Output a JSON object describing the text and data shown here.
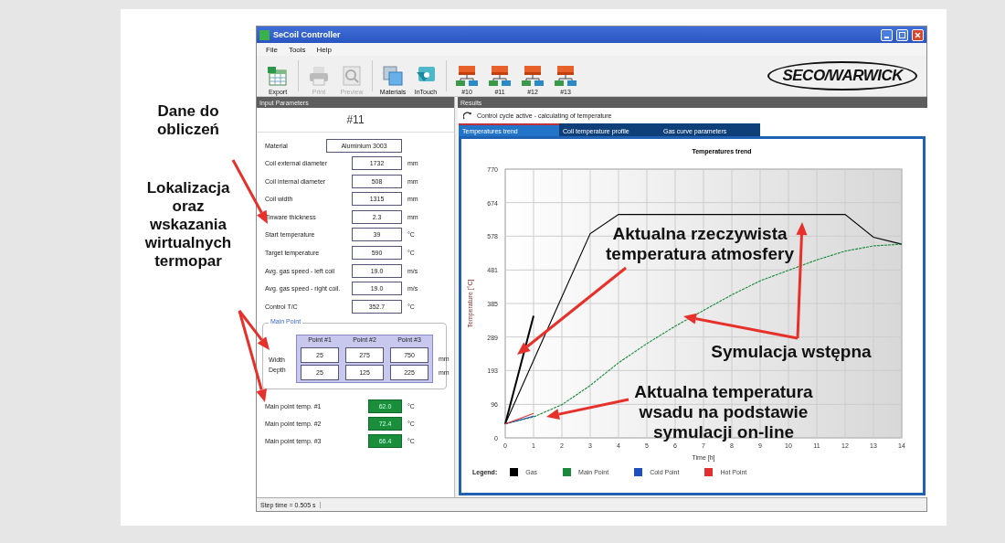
{
  "annotations_left": [
    {
      "text": "Dane do obliczeń"
    },
    {
      "text": "Lokalizacja oraz wskazania wirtualnych termopar"
    }
  ],
  "window": {
    "title": "SeCoil Controller",
    "menu": [
      "File",
      "Tools",
      "Help"
    ],
    "toolbar": [
      {
        "kind": "export",
        "label": "Export",
        "disabled": false
      },
      {
        "kind": "print",
        "label": "Print",
        "disabled": true
      },
      {
        "kind": "preview",
        "label": "Preview",
        "disabled": true
      },
      {
        "kind": "materials",
        "label": "Materials",
        "disabled": false
      },
      {
        "kind": "intouch",
        "label": "InTouch",
        "disabled": false
      },
      {
        "kind": "coil",
        "label": "#10",
        "disabled": false
      },
      {
        "kind": "coil",
        "label": "#11",
        "disabled": false
      },
      {
        "kind": "coil",
        "label": "#12",
        "disabled": false
      },
      {
        "kind": "coil",
        "label": "#13",
        "disabled": false
      }
    ],
    "logo": "SECO/WARWICK"
  },
  "input_panel": {
    "title": "Input Parameters",
    "coil": "#11",
    "fields": [
      {
        "kind": "wide",
        "label": "Material",
        "value": "Aluminium 3003"
      },
      {
        "kind": "number",
        "label": "Coil external diameter",
        "value": "1732",
        "unit": "mm"
      },
      {
        "kind": "number",
        "label": "Coil internal diameter",
        "value": "508",
        "unit": "mm"
      },
      {
        "kind": "number",
        "label": "Coil width",
        "value": "1315",
        "unit": "mm"
      },
      {
        "kind": "number",
        "label": "Tinware thickness",
        "value": "2.3",
        "unit": "mm"
      },
      {
        "kind": "number",
        "label": "Start temperature",
        "value": "39",
        "unit": "°C"
      },
      {
        "kind": "number",
        "label": "Target temperature",
        "value": "590",
        "unit": "°C"
      },
      {
        "kind": "number",
        "label": "Avg. gas speed - left coil",
        "value": "19.0",
        "unit": "m/s"
      },
      {
        "kind": "number",
        "label": "Avg. gas speed - right coil.",
        "value": "19.0",
        "unit": "m/s"
      },
      {
        "kind": "number",
        "label": "Control T/C",
        "value": "352.7",
        "unit": "°C"
      }
    ],
    "main_point": {
      "title": "Main Point",
      "columns": [
        "Point #1",
        "Point #2",
        "Point #3"
      ],
      "rows": [
        {
          "label": "Width",
          "values": [
            "25",
            "275",
            "750"
          ],
          "unit": "mm"
        },
        {
          "label": "Depth",
          "values": [
            "25",
            "125",
            "225"
          ],
          "unit": "mm"
        }
      ]
    },
    "temps": [
      {
        "label": "Main point temp. #1",
        "value": "62.0",
        "unit": "°C"
      },
      {
        "label": "Main point temp. #2",
        "value": "72.4",
        "unit": "°C"
      },
      {
        "label": "Main point temp. #3",
        "value": "66.4",
        "unit": "°C"
      }
    ]
  },
  "results": {
    "title": "Results",
    "status": "Control cycle active - calculating of temperature",
    "tabs": [
      {
        "label": "Temperatures trend",
        "selected": true
      },
      {
        "label": "Coil temperature profile",
        "selected": false
      },
      {
        "label": "Gas curve parameters",
        "selected": false
      }
    ],
    "chart_data": {
      "type": "line",
      "grid": true,
      "title": "Temperatures trend",
      "xlabel": "Time [h]",
      "ylabel": "Temperature [°C]",
      "x": [
        0,
        1,
        2,
        3,
        4,
        5,
        6,
        7,
        8,
        9,
        10,
        11,
        12,
        13,
        14
      ],
      "xlim": [
        0,
        14
      ],
      "ylim": [
        0,
        770
      ],
      "xticks": [
        0,
        1,
        2,
        3,
        4,
        5,
        6,
        7,
        8,
        9,
        10,
        11,
        12,
        13,
        14
      ],
      "yticks": [
        0,
        96,
        193,
        289,
        385,
        481,
        578,
        674,
        770
      ],
      "series": [
        {
          "name": "Gas",
          "color": "#000000",
          "line_style": "solid",
          "values": [
            40,
            222,
            404,
            585,
            640,
            640,
            640,
            640,
            640,
            640,
            640,
            640,
            640,
            575,
            555
          ]
        },
        {
          "name": "Main Point",
          "color": "#1a8a3a",
          "line_style": "dashed",
          "values": [
            40,
            60,
            95,
            150,
            215,
            270,
            320,
            365,
            410,
            450,
            480,
            510,
            535,
            550,
            555
          ]
        },
        {
          "color": "#000000",
          "line_style": "solid",
          "values": [
            40,
            350,
            null,
            null,
            null,
            null,
            null,
            null,
            null,
            null,
            null,
            null,
            null,
            null,
            null
          ]
        },
        {
          "name": "Cold Point",
          "color": "#1f4fbf",
          "line_style": "solid",
          "values": [
            40,
            62,
            null,
            null,
            null,
            null,
            null,
            null,
            null,
            null,
            null,
            null,
            null,
            null,
            null
          ]
        },
        {
          "name": "Hot Point",
          "color": "#e03030",
          "line_style": "solid",
          "values": [
            40,
            70,
            null,
            null,
            null,
            null,
            null,
            null,
            null,
            null,
            null,
            null,
            null,
            null,
            null
          ]
        }
      ]
    },
    "legend_title": "Legend:"
  },
  "chart_annotations": [
    {
      "text": "Aktualna rzeczywista temperatura atmosfery"
    },
    {
      "text": "Symulacja wstępna"
    },
    {
      "text": "Aktualna temperatura wsadu na podstawie symulacji on-line"
    }
  ],
  "status_bar": "Step time = 0.505 s"
}
